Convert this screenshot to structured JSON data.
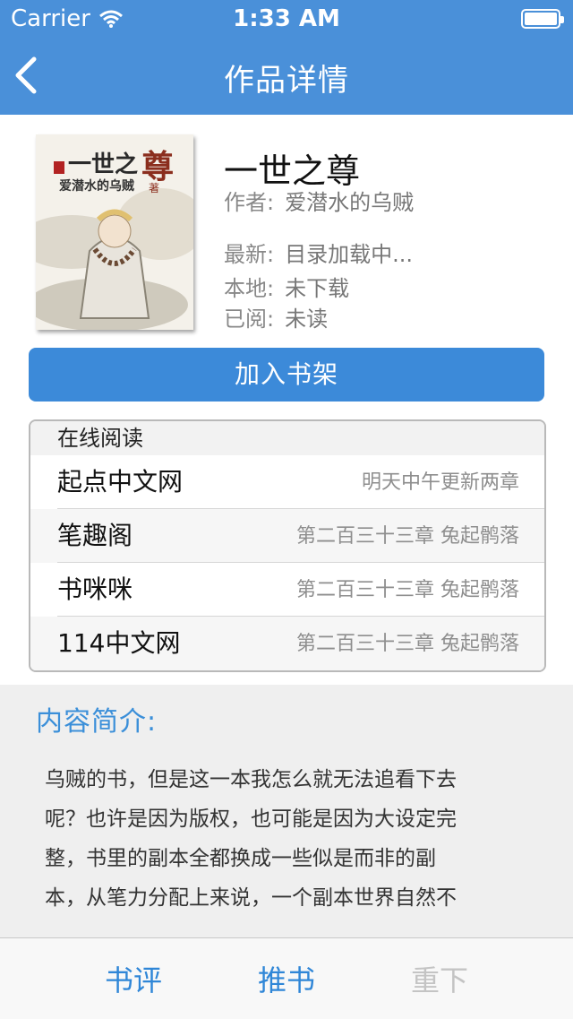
{
  "status_bar": {
    "carrier": "Carrier",
    "time": "1:33 AM"
  },
  "nav": {
    "title": "作品详情"
  },
  "book": {
    "title": "一世之尊",
    "author_label": "作者:",
    "author": "爱潜水的乌贼",
    "latest_label": "最新:",
    "latest": "目录加载中...",
    "local_label": "本地:",
    "local": "未下载",
    "read_label": "已阅:",
    "read": "未读",
    "cover_title": "一世之尊",
    "cover_author": "爱潜水的乌贼"
  },
  "actions": {
    "add_shelf": "加入书架"
  },
  "online": {
    "header": "在线阅读",
    "sources": [
      {
        "name": "起点中文网",
        "info": "明天中午更新两章"
      },
      {
        "name": "笔趣阁",
        "info": "第二百三十三章 兔起鹘落"
      },
      {
        "name": "书咪咪",
        "info": "第二百三十三章 兔起鹘落"
      },
      {
        "name": "114中文网",
        "info": "第二百三十三章 兔起鹘落"
      }
    ]
  },
  "intro": {
    "title": "内容简介:",
    "lines": [
      "乌贼的书，但是这一本我怎么就无法追看下去",
      "呢？也许是因为版权，也可能是因为大设定完",
      "整，书里的副本全都换成一些似是而非的副",
      "本，从笔力分配上来说，一个副本世界自然不"
    ]
  },
  "tabbar": {
    "review": "书评",
    "recommend": "推书",
    "redownload": "重下"
  },
  "colors": {
    "header": "#4a90d9",
    "accent": "#3c8ad9",
    "link": "#2f86d7"
  }
}
